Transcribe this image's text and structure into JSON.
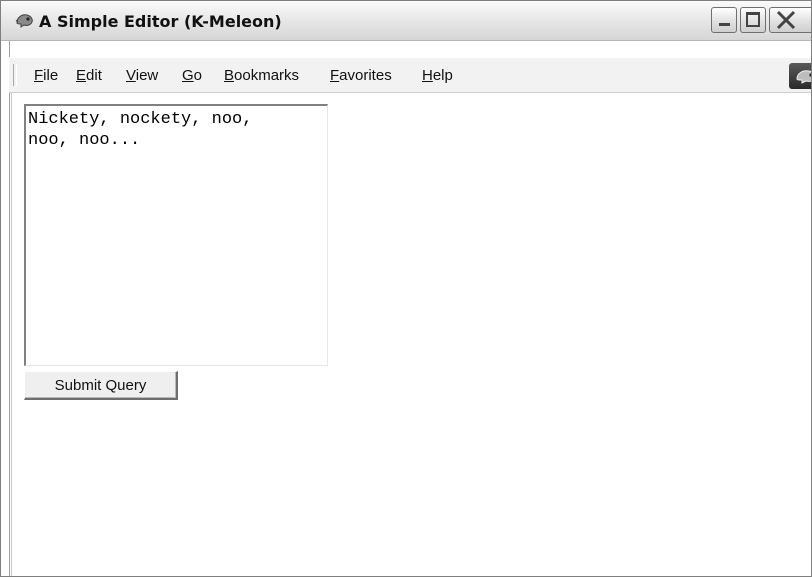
{
  "window": {
    "title": "A Simple Editor (K-Meleon)",
    "app_icon": "k-meleon-icon",
    "controls": {
      "minimize": "minimize-icon",
      "maximize": "maximize-icon",
      "close": "close-icon"
    }
  },
  "menubar": {
    "items": [
      {
        "accel": "F",
        "rest": "ile"
      },
      {
        "accel": "E",
        "rest": "dit"
      },
      {
        "accel": "V",
        "rest": "iew"
      },
      {
        "accel": "G",
        "rest": "o"
      },
      {
        "accel": "B",
        "rest": "ookmarks"
      },
      {
        "accel": "F",
        "rest": "avorites"
      },
      {
        "accel": "H",
        "rest": "elp"
      }
    ],
    "throbber_icon": "k-meleon-throbber-icon"
  },
  "page": {
    "editor_value": "Nickety, nockety, noo,\nnoo, noo...",
    "submit_label": "Submit Query"
  },
  "colors": {
    "titlebar_top": "#fbfbfb",
    "titlebar_bottom": "#d6d6d6",
    "menubar_bg": "#f2f2f2",
    "content_bg": "#ffffff"
  }
}
